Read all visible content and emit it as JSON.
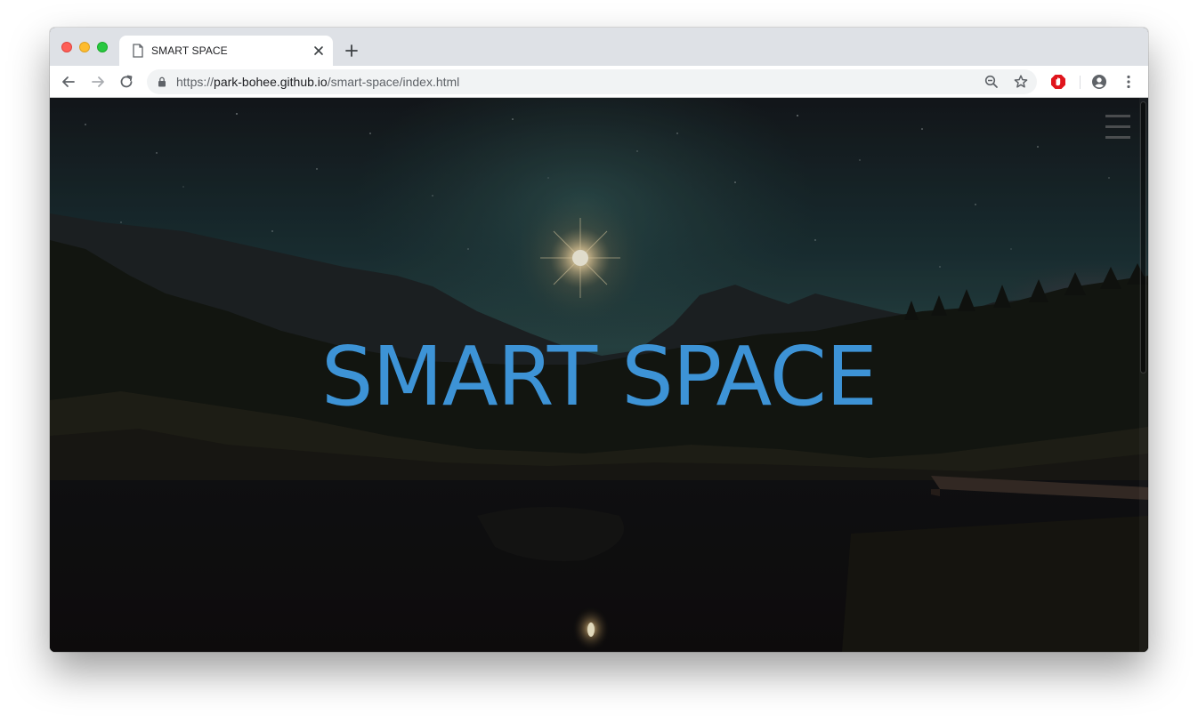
{
  "browser": {
    "tab": {
      "title": "SMART SPACE"
    },
    "address_bar": {
      "scheme": "https://",
      "host": "park-bohee.github.io",
      "path": "/smart-space/index.html"
    }
  },
  "page": {
    "hero_title": "SMART SPACE",
    "accent_color": "#3d93d6",
    "menu_icon": "hamburger-menu-icon"
  },
  "icons": {
    "back": "back-arrow-icon",
    "forward": "forward-arrow-icon",
    "reload": "reload-icon",
    "lock": "lock-icon",
    "zoom": "zoom-out-icon",
    "bookmark": "star-icon",
    "extension": "adblock-icon",
    "profile": "account-icon",
    "menu": "kebab-menu-icon",
    "new_tab": "plus-icon",
    "tab_close": "close-icon",
    "favicon": "document-icon"
  }
}
